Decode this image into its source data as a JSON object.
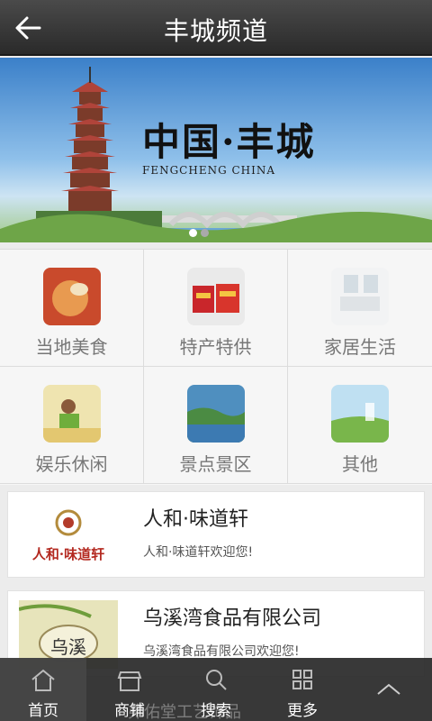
{
  "header": {
    "title": "丰城频道",
    "back_icon": "back-arrow-icon"
  },
  "banner": {
    "title": "中国·丰城",
    "subtitle": "FENGCHENG   CHINA",
    "dots": [
      true,
      false
    ]
  },
  "grid": [
    {
      "label": "当地美食",
      "icon": "local-food-thumb"
    },
    {
      "label": "特产特供",
      "icon": "specialty-thumb"
    },
    {
      "label": "家居生活",
      "icon": "home-living-thumb"
    },
    {
      "label": "娱乐休闲",
      "icon": "leisure-thumb"
    },
    {
      "label": "景点景区",
      "icon": "scenic-spot-thumb"
    },
    {
      "label": "其他",
      "icon": "other-thumb"
    }
  ],
  "list": [
    {
      "name": "人和·味道轩",
      "desc": "人和·味道轩欢迎您!",
      "logo_text": "人和·味道轩"
    },
    {
      "name": "乌溪湾食品有限公司",
      "desc": "乌溪湾食品有限公司欢迎您!",
      "logo_text": "乌溪"
    }
  ],
  "bottom_nav": [
    {
      "label": "首页",
      "icon": "home-icon",
      "active": true
    },
    {
      "label": "商铺",
      "icon": "shop-icon",
      "active": false
    },
    {
      "label": "搜索",
      "icon": "search-icon",
      "active": false
    },
    {
      "label": "更多",
      "icon": "grid-icon",
      "active": false
    },
    {
      "label": "",
      "icon": "chevron-up-icon",
      "active": false
    }
  ],
  "ghost_text": "弗佑堂工艺饰品"
}
